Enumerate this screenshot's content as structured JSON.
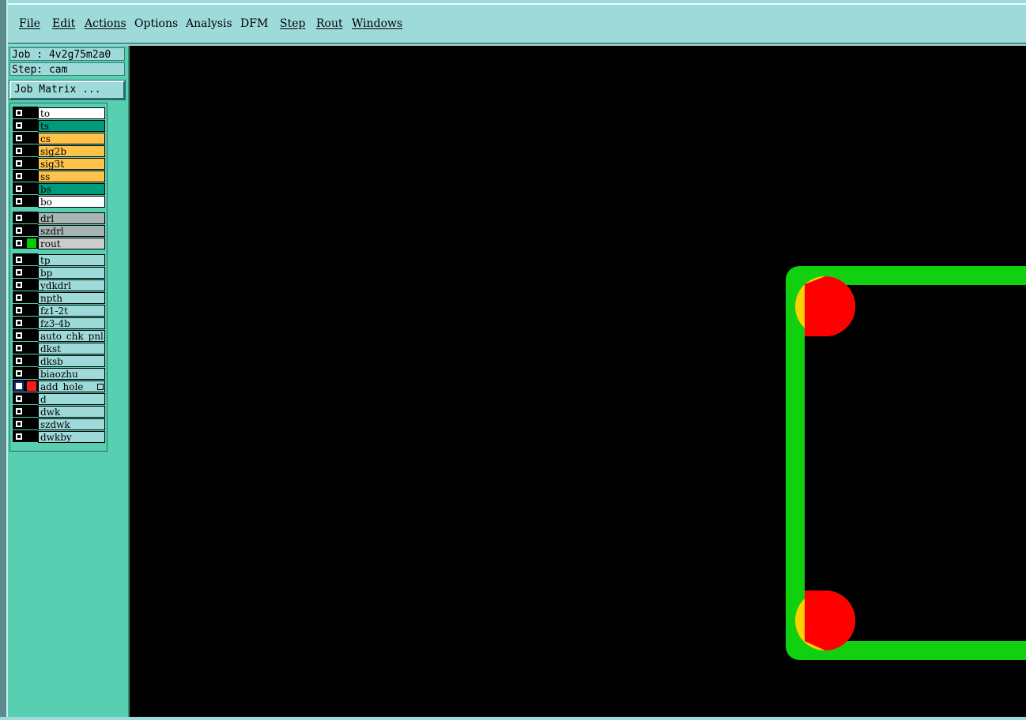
{
  "menu": [
    "File",
    "Edit",
    "Actions",
    "Options",
    "Analysis",
    "DFM",
    "Step",
    "Rout",
    "Windows"
  ],
  "info": {
    "job": "Job : 4v2g75m2a0",
    "step": "Step: cam",
    "job_matrix": "Job Matrix ..."
  },
  "layer_groups": [
    [
      {
        "name": "to",
        "color": "#ffffff"
      },
      {
        "name": "ts",
        "color": "#009b7a"
      },
      {
        "name": "cs",
        "color": "#ffc24a"
      },
      {
        "name": "sig2b",
        "color": "#ffc24a"
      },
      {
        "name": "sig3t",
        "color": "#ffc24a"
      },
      {
        "name": "ss",
        "color": "#ffc24a"
      },
      {
        "name": "bs",
        "color": "#009b7a"
      },
      {
        "name": "bo",
        "color": "#ffffff"
      }
    ],
    [
      {
        "name": "drl",
        "color": "#a8b4b4"
      },
      {
        "name": "szdrl",
        "color": "#a8b4b4"
      },
      {
        "name": "rout",
        "color": "#cccccc",
        "swatch": "#00cc00"
      }
    ],
    [
      {
        "name": "tp",
        "color": "#9fdada"
      },
      {
        "name": "bp",
        "color": "#9fdada"
      },
      {
        "name": "ydkdrl",
        "color": "#9fdada"
      },
      {
        "name": "npth",
        "color": "#9fdada"
      },
      {
        "name": "fz1-2t",
        "color": "#9fdada"
      },
      {
        "name": "fz3-4b",
        "color": "#9fdada"
      },
      {
        "name": "auto_chk_pnl",
        "color": "#9fdada"
      },
      {
        "name": "dkst",
        "color": "#9fdada"
      },
      {
        "name": "dksb",
        "color": "#9fdada"
      },
      {
        "name": "biaozhu",
        "color": "#9fdada"
      },
      {
        "name": "add_hole",
        "color": "#9fdada",
        "swatch": "#ff1a1a",
        "active": true
      },
      {
        "name": "d",
        "color": "#9fdada"
      },
      {
        "name": "dwk",
        "color": "#9fdada"
      },
      {
        "name": "szdwk",
        "color": "#9fdada"
      },
      {
        "name": "dwkby",
        "color": "#9fdada"
      }
    ]
  ],
  "colors": {
    "rout": "#10d010",
    "hole_outer": "#ffd000",
    "hole_inner": "#ff0000",
    "canvas_bg": "#000000"
  }
}
